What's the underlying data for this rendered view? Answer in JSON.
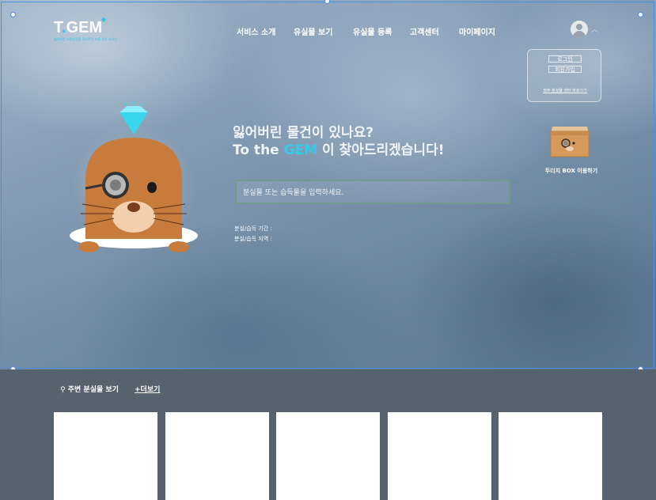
{
  "logo": {
    "text_main": "T",
    "text_dot": ".",
    "text_rest": "GEM",
    "tagline": "잃어버린 소중한것을 찾아주는 보물 같은 서비스"
  },
  "nav": {
    "items": [
      "서비스 소개",
      "유실물 보기",
      "유실물 등록",
      "고객센터",
      "마이페이지"
    ]
  },
  "account": {
    "login": "로그인",
    "signup": "회원가입",
    "external_link": "외부 분실물 센터 바로가기"
  },
  "mole_box": {
    "label": "두더지 BOX 이용하기"
  },
  "hero": {
    "line1": "잃어버린 물건이 있나요?",
    "line2_prefix": "To the ",
    "line2_brand": "GEM",
    "line2_suffix": " 이 찾아드리겠습니다!"
  },
  "search": {
    "placeholder": "분실물 또는 습득물을 입력하세요."
  },
  "meta": {
    "period_label": "분실/습득 기간 :",
    "region_label": "분실/습득 지역 :"
  },
  "nearby": {
    "title": "주변 분실물 보기",
    "more": "+더보기",
    "cards": [
      "",
      "",
      "",
      "",
      ""
    ]
  },
  "colors": {
    "accent": "#38c9e8",
    "selection": "#4a90e2",
    "footer_bg": "#56636f"
  }
}
